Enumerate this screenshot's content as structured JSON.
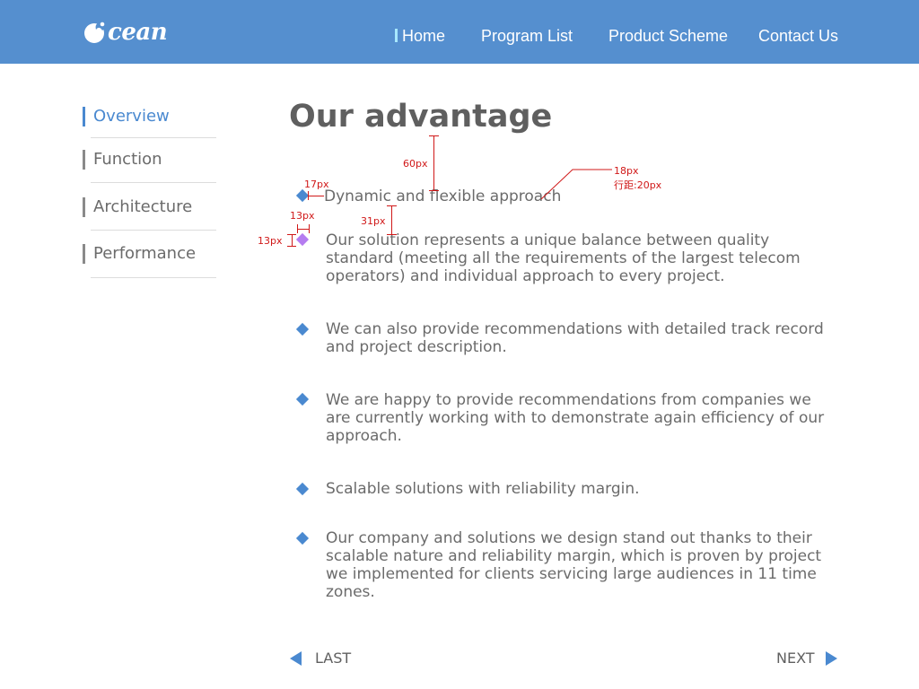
{
  "brand": {
    "logo_text": "cean"
  },
  "nav": {
    "items": [
      {
        "label": "Home"
      },
      {
        "label": "Program List"
      },
      {
        "label": "Product Scheme"
      },
      {
        "label": "Contact Us"
      }
    ]
  },
  "sidebar": {
    "items": [
      {
        "label": "Overview",
        "active": true
      },
      {
        "label": "Function"
      },
      {
        "label": "Architecture"
      },
      {
        "label": "Performance"
      }
    ]
  },
  "content": {
    "title": "Our advantage",
    "first_item": "Dynamic and flexible approach",
    "items": [
      "Our solution represents a unique balance between quality standard (meeting all the requirements of the largest telecom operators) and individual approach to every project.",
      "We can also provide recommendations with detailed track record and project description.",
      "We are happy to provide recommendations from companies we are currently working with to demonstrate again efficiency of our approach.",
      "Scalable solutions with reliability margin.",
      "Our company and solutions we design stand out thanks to their scalable nature and reliability margin, which is proven by project we implemented for clients servicing large audiences in 11 time zones."
    ]
  },
  "annotations": {
    "gap_60": "60px",
    "gap_17": "17px",
    "gap_13a": "13px",
    "gap_13b": "13px",
    "gap_31": "31px",
    "font_size": "18px",
    "line_spacing": "行距:20px"
  },
  "pager": {
    "prev_label": "LAST",
    "next_label": "NEXT"
  },
  "colors": {
    "header_bg": "#558fcf",
    "accent": "#4a89d0",
    "text": "#6b6b6b",
    "annotation": "#d01818",
    "selected_bullet": "#b57cf0"
  },
  "icons": {
    "logo": "ocean-wave-logo-icon",
    "prev": "triangle-left-icon",
    "next": "triangle-right-icon",
    "bullet": "diamond-bullet-icon"
  }
}
